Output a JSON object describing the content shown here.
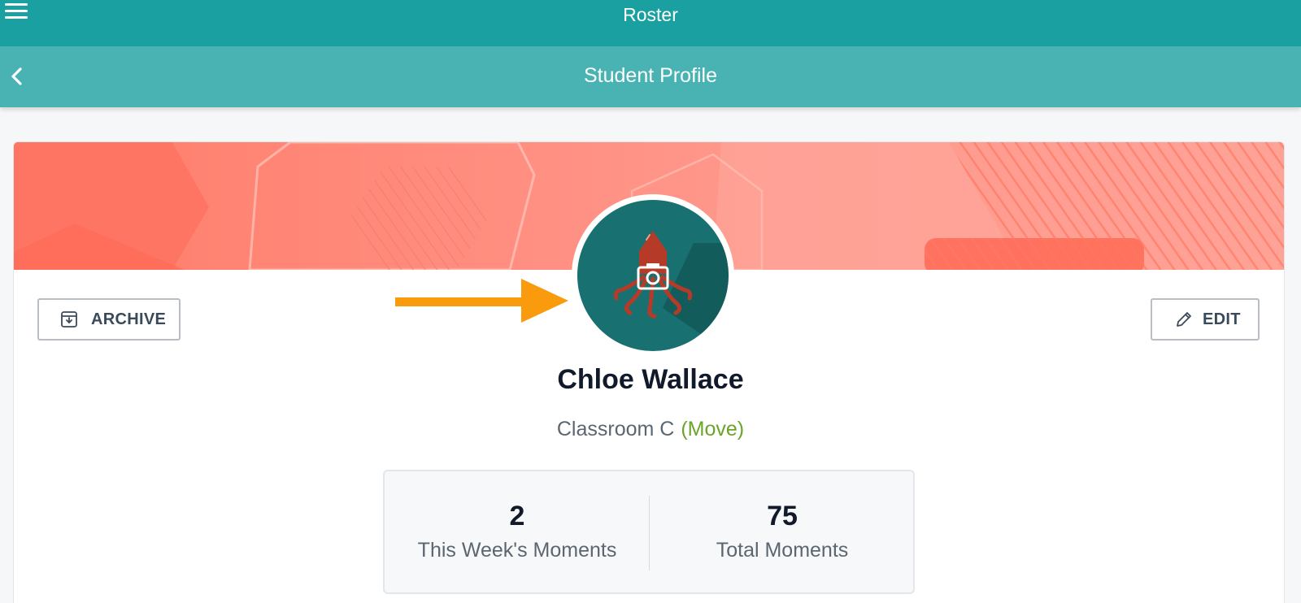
{
  "topbar": {
    "title": "Roster",
    "menu_icon": "hamburger-menu-icon"
  },
  "subbar": {
    "title": "Student Profile",
    "back_icon": "chevron-left-icon"
  },
  "profile": {
    "name": "Chloe Wallace",
    "classroom": "Classroom C",
    "move_label": "(Move)",
    "avatar_icon": "squid-avatar-icon",
    "photo_icon": "camera-icon"
  },
  "actions": {
    "archive_label": "ARCHIVE",
    "edit_label": "EDIT"
  },
  "stats": [
    {
      "value": "2",
      "label": "This Week's Moments"
    },
    {
      "value": "75",
      "label": "Total Moments"
    }
  ],
  "colors": {
    "topbar": "#1aa0a0",
    "subbar": "#49b2b2",
    "banner": "#ff8a78",
    "avatar_bg": "#187070",
    "squid": "#b53b28",
    "arrow": "#f99b0c",
    "move_link": "#6aa52a"
  }
}
